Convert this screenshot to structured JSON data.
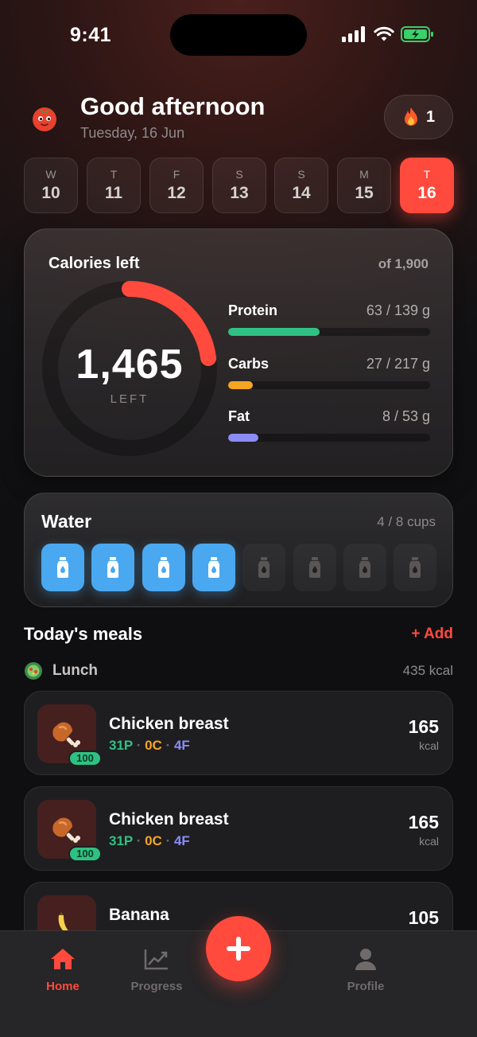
{
  "status": {
    "time": "9:41"
  },
  "header": {
    "greeting": "Good afternoon",
    "date": "Tuesday, 16 Jun",
    "streak": "1",
    "mascot_icon": "tomato-mascot"
  },
  "week": [
    {
      "letter": "W",
      "num": "10"
    },
    {
      "letter": "T",
      "num": "11"
    },
    {
      "letter": "F",
      "num": "12"
    },
    {
      "letter": "S",
      "num": "13"
    },
    {
      "letter": "S",
      "num": "14"
    },
    {
      "letter": "M",
      "num": "15"
    },
    {
      "letter": "T",
      "num": "16"
    }
  ],
  "calories": {
    "title": "Calories left",
    "of_label": "of 1,900",
    "left_value": "1,465",
    "left_label": "LEFT",
    "progress": 0.229,
    "ring_color": "#ff4a3d"
  },
  "macros": [
    {
      "name": "Protein",
      "value": "63 / 139 g",
      "progress": 0.453,
      "color": "#2fc183"
    },
    {
      "name": "Carbs",
      "value": "27 / 217 g",
      "progress": 0.124,
      "color": "#f5a524"
    },
    {
      "name": "Fat",
      "value": "8 / 53 g",
      "progress": 0.151,
      "color": "#8b8cf5"
    }
  ],
  "water": {
    "title": "Water",
    "count": "4 / 8 cups",
    "filled": 4,
    "total": 8,
    "color": "#4aa8f0"
  },
  "meals": {
    "title": "Today's meals",
    "add_label": "+ Add",
    "section": {
      "name": "Lunch",
      "kcal": "435 kcal"
    },
    "items": [
      {
        "name": "Chicken breast",
        "protein": "31P",
        "carbs": "0C",
        "fat": "4F",
        "kcal": "165",
        "unit": "kcal",
        "badge": "100",
        "icon": "chicken-leg"
      },
      {
        "name": "Chicken breast",
        "protein": "31P",
        "carbs": "0C",
        "fat": "4F",
        "kcal": "165",
        "unit": "kcal",
        "badge": "100",
        "icon": "chicken-leg"
      },
      {
        "name": "Banana",
        "kcal": "105",
        "icon": "banana"
      }
    ]
  },
  "tabs": {
    "home": "Home",
    "progress": "Progress",
    "profile": "Profile"
  }
}
